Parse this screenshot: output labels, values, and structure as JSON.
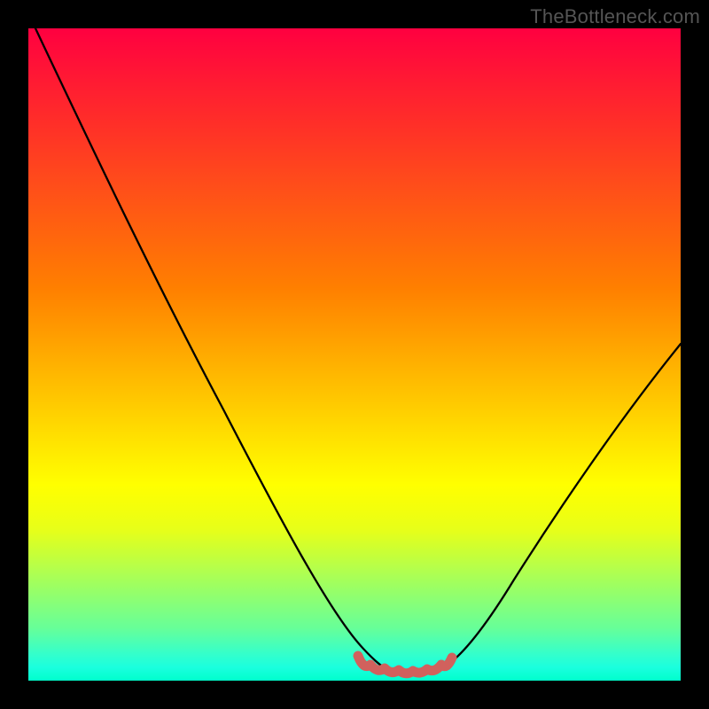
{
  "watermark": "TheBottleneck.com",
  "colors": {
    "frame": "#000000",
    "curve": "#000000",
    "highlight": "#d1615d",
    "gradient_top": "#ff0040",
    "gradient_bottom": "#00ffcc"
  },
  "chart_data": {
    "type": "line",
    "title": "",
    "xlabel": "",
    "ylabel": "",
    "xlim": [
      0,
      100
    ],
    "ylim": [
      0,
      100
    ],
    "series": [
      {
        "name": "bottleneck-curve",
        "x": [
          0,
          3,
          6,
          9,
          12,
          15,
          18,
          21,
          24,
          27,
          30,
          33,
          36,
          39,
          42,
          45,
          48,
          50,
          53,
          56,
          59,
          62,
          63,
          65,
          68,
          71,
          74,
          77,
          80,
          83,
          86,
          89,
          92,
          95,
          98,
          100
        ],
        "y": [
          100,
          95,
          90,
          85,
          80,
          75,
          69,
          63,
          58,
          52,
          46,
          40,
          35,
          29,
          23,
          18,
          12,
          8,
          4,
          2,
          1,
          1,
          1,
          2,
          4,
          7,
          11,
          15,
          20,
          25,
          30,
          35,
          40,
          45,
          49,
          52
        ]
      },
      {
        "name": "optimal-region",
        "x": [
          50,
          52,
          54,
          56,
          58,
          60,
          62,
          63
        ],
        "y": [
          3,
          2,
          1.5,
          1.2,
          1.2,
          1.3,
          1.6,
          2.2
        ]
      }
    ]
  }
}
